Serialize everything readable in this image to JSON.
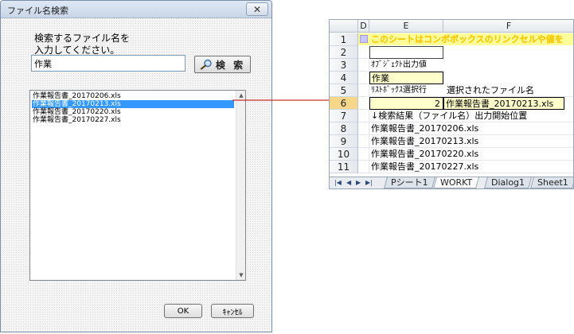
{
  "dialog": {
    "title": "ファイル名検索",
    "close_label": "✕",
    "prompt": "検索するファイル名を\n入力してください。",
    "search_value": "作業",
    "search_button_label": "検 索",
    "list_items": [
      "作業報告書_20170206.xls",
      "作業報告書_20170213.xls",
      "作業報告書_20170220.xls",
      "作業報告書_20170227.xls"
    ],
    "selected_index": 1,
    "ok_label": "OK",
    "cancel_label": "ｷｬﾝｾﾙ"
  },
  "sheet": {
    "columns": [
      "D",
      "E",
      "F"
    ],
    "rows": [
      "1",
      "2",
      "3",
      "4",
      "5",
      "6",
      "7",
      "8",
      "9",
      "10",
      "11"
    ],
    "active_row": "6",
    "banner": "このシートはコンボボックスのリンクセルや値を",
    "object_output_label": "ｵﾌﾞｼﾞｪｸﾄ出力値",
    "object_output_value": "作業",
    "listbox_row_label": "ﾘｽﾄﾎﾞｯｸｽ選択行",
    "selected_file_label": "選択されたファイル名",
    "listbox_row_value": "2",
    "selected_file_value": "作業報告書_20170213.xls",
    "result_start_label": "↓検索結果（ファイル名）出力開始位置",
    "results": [
      "作業報告書_20170206.xls",
      "作業報告書_20170213.xls",
      "作業報告書_20170220.xls",
      "作業報告書_20170227.xls"
    ],
    "tabs": [
      "Pシート1",
      "WORKT",
      "Dialog1",
      "Sheet1"
    ],
    "active_tab": "WORKT"
  }
}
